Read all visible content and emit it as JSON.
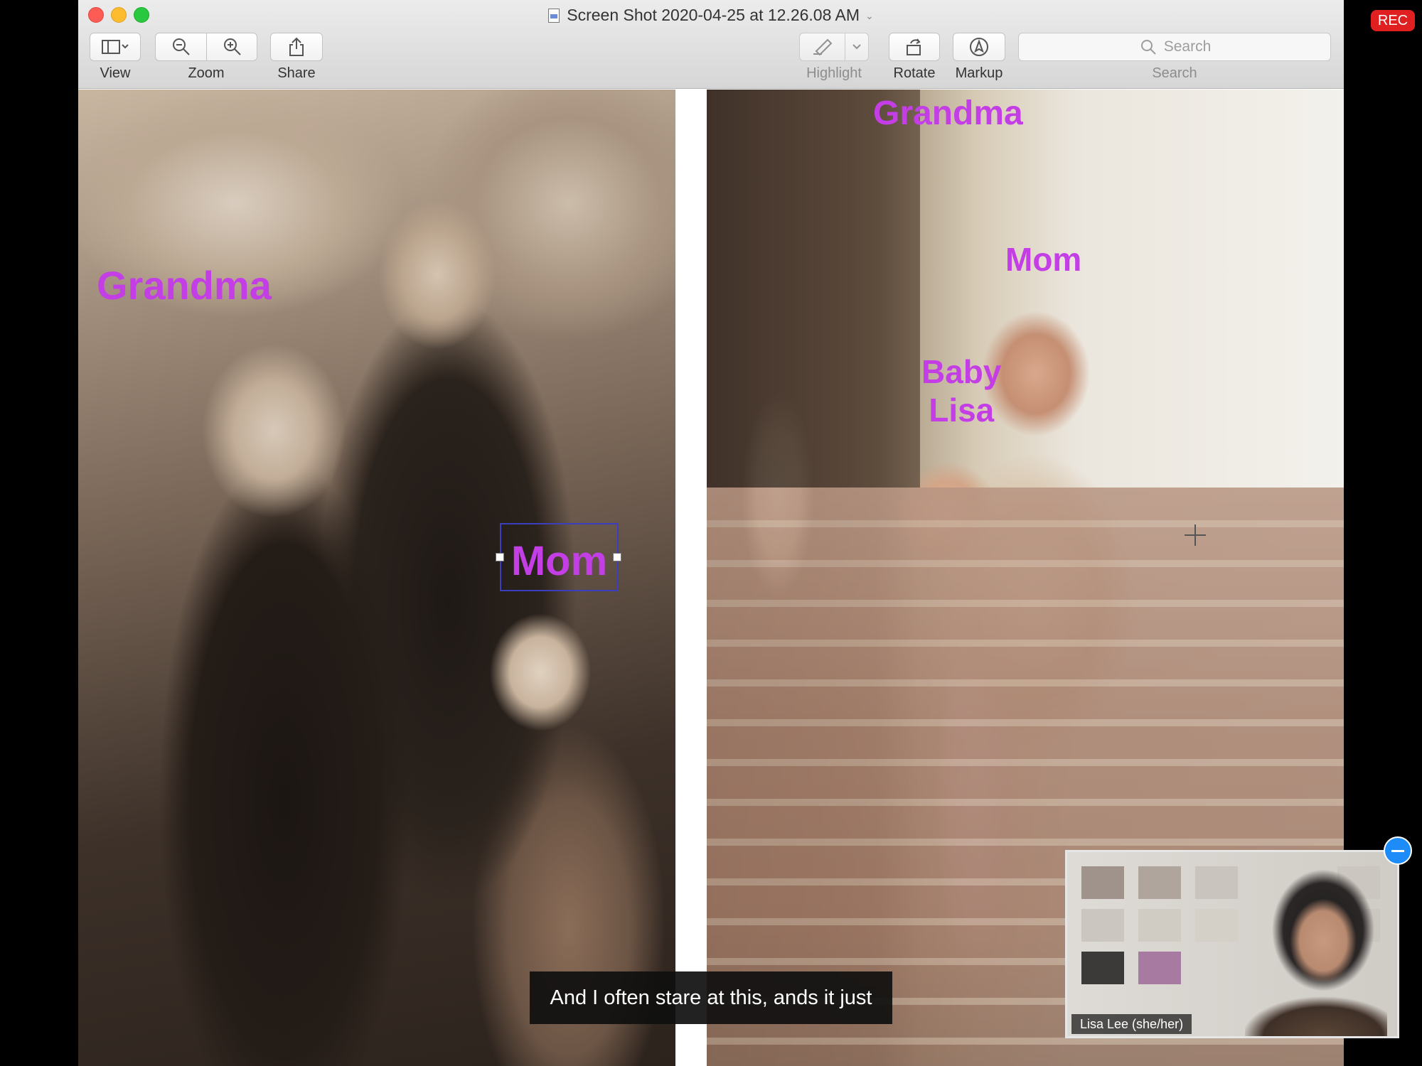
{
  "recording": {
    "label": "REC"
  },
  "window": {
    "title": "Screen Shot 2020-04-25 at 12.26.08 AM"
  },
  "toolbar": {
    "view_label": "View",
    "zoom_label": "Zoom",
    "share_label": "Share",
    "highlight_label": "Highlight",
    "rotate_label": "Rotate",
    "markup_label": "Markup",
    "search_label": "Search",
    "search_placeholder": "Search"
  },
  "annotations": {
    "grandma_left": "Grandma",
    "mom_left": "Mom",
    "grandma_right": "Grandma",
    "mom_right": "Mom",
    "baby_line1": "Baby",
    "baby_line2": "Lisa",
    "color": "#c33fe5"
  },
  "caption": {
    "text": "And I often stare at this, ands it just"
  },
  "video": {
    "participant_name": "Lisa Lee (she/her)"
  }
}
